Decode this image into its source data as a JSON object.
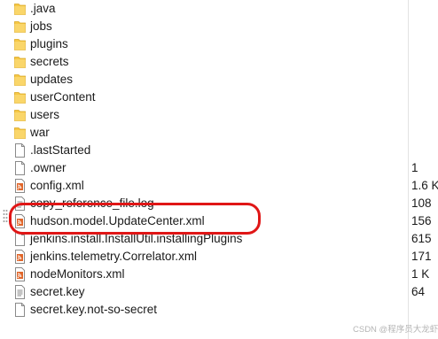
{
  "files": [
    {
      "name": ".java",
      "type": "folder",
      "size": ""
    },
    {
      "name": "jobs",
      "type": "folder",
      "size": ""
    },
    {
      "name": "plugins",
      "type": "folder",
      "size": ""
    },
    {
      "name": "secrets",
      "type": "folder",
      "size": ""
    },
    {
      "name": "updates",
      "type": "folder",
      "size": ""
    },
    {
      "name": "userContent",
      "type": "folder",
      "size": ""
    },
    {
      "name": "users",
      "type": "folder",
      "size": ""
    },
    {
      "name": "war",
      "type": "folder",
      "size": ""
    },
    {
      "name": ".lastStarted",
      "type": "file",
      "size": ""
    },
    {
      "name": ".owner",
      "type": "file",
      "size": "1"
    },
    {
      "name": "config.xml",
      "type": "xml",
      "size": "1.6 K"
    },
    {
      "name": "copy_reference_file.log",
      "type": "text",
      "size": "108"
    },
    {
      "name": "hudson.model.UpdateCenter.xml",
      "type": "xml",
      "size": "156"
    },
    {
      "name": "jenkins.install.InstallUtil.installingPlugins",
      "type": "file",
      "size": "615"
    },
    {
      "name": "jenkins.telemetry.Correlator.xml",
      "type": "xml",
      "size": "171"
    },
    {
      "name": "nodeMonitors.xml",
      "type": "xml",
      "size": "1 K"
    },
    {
      "name": "secret.key",
      "type": "text",
      "size": "64"
    },
    {
      "name": "secret.key.not-so-secret",
      "type": "file",
      "size": ""
    }
  ],
  "highlighted_file": "hudson.model.UpdateCenter.xml",
  "watermark": "CSDN @程序员大龙虾",
  "colors": {
    "folder": "#f6c845",
    "highlight": "#e01616",
    "xml_icon": "#e0662a"
  }
}
